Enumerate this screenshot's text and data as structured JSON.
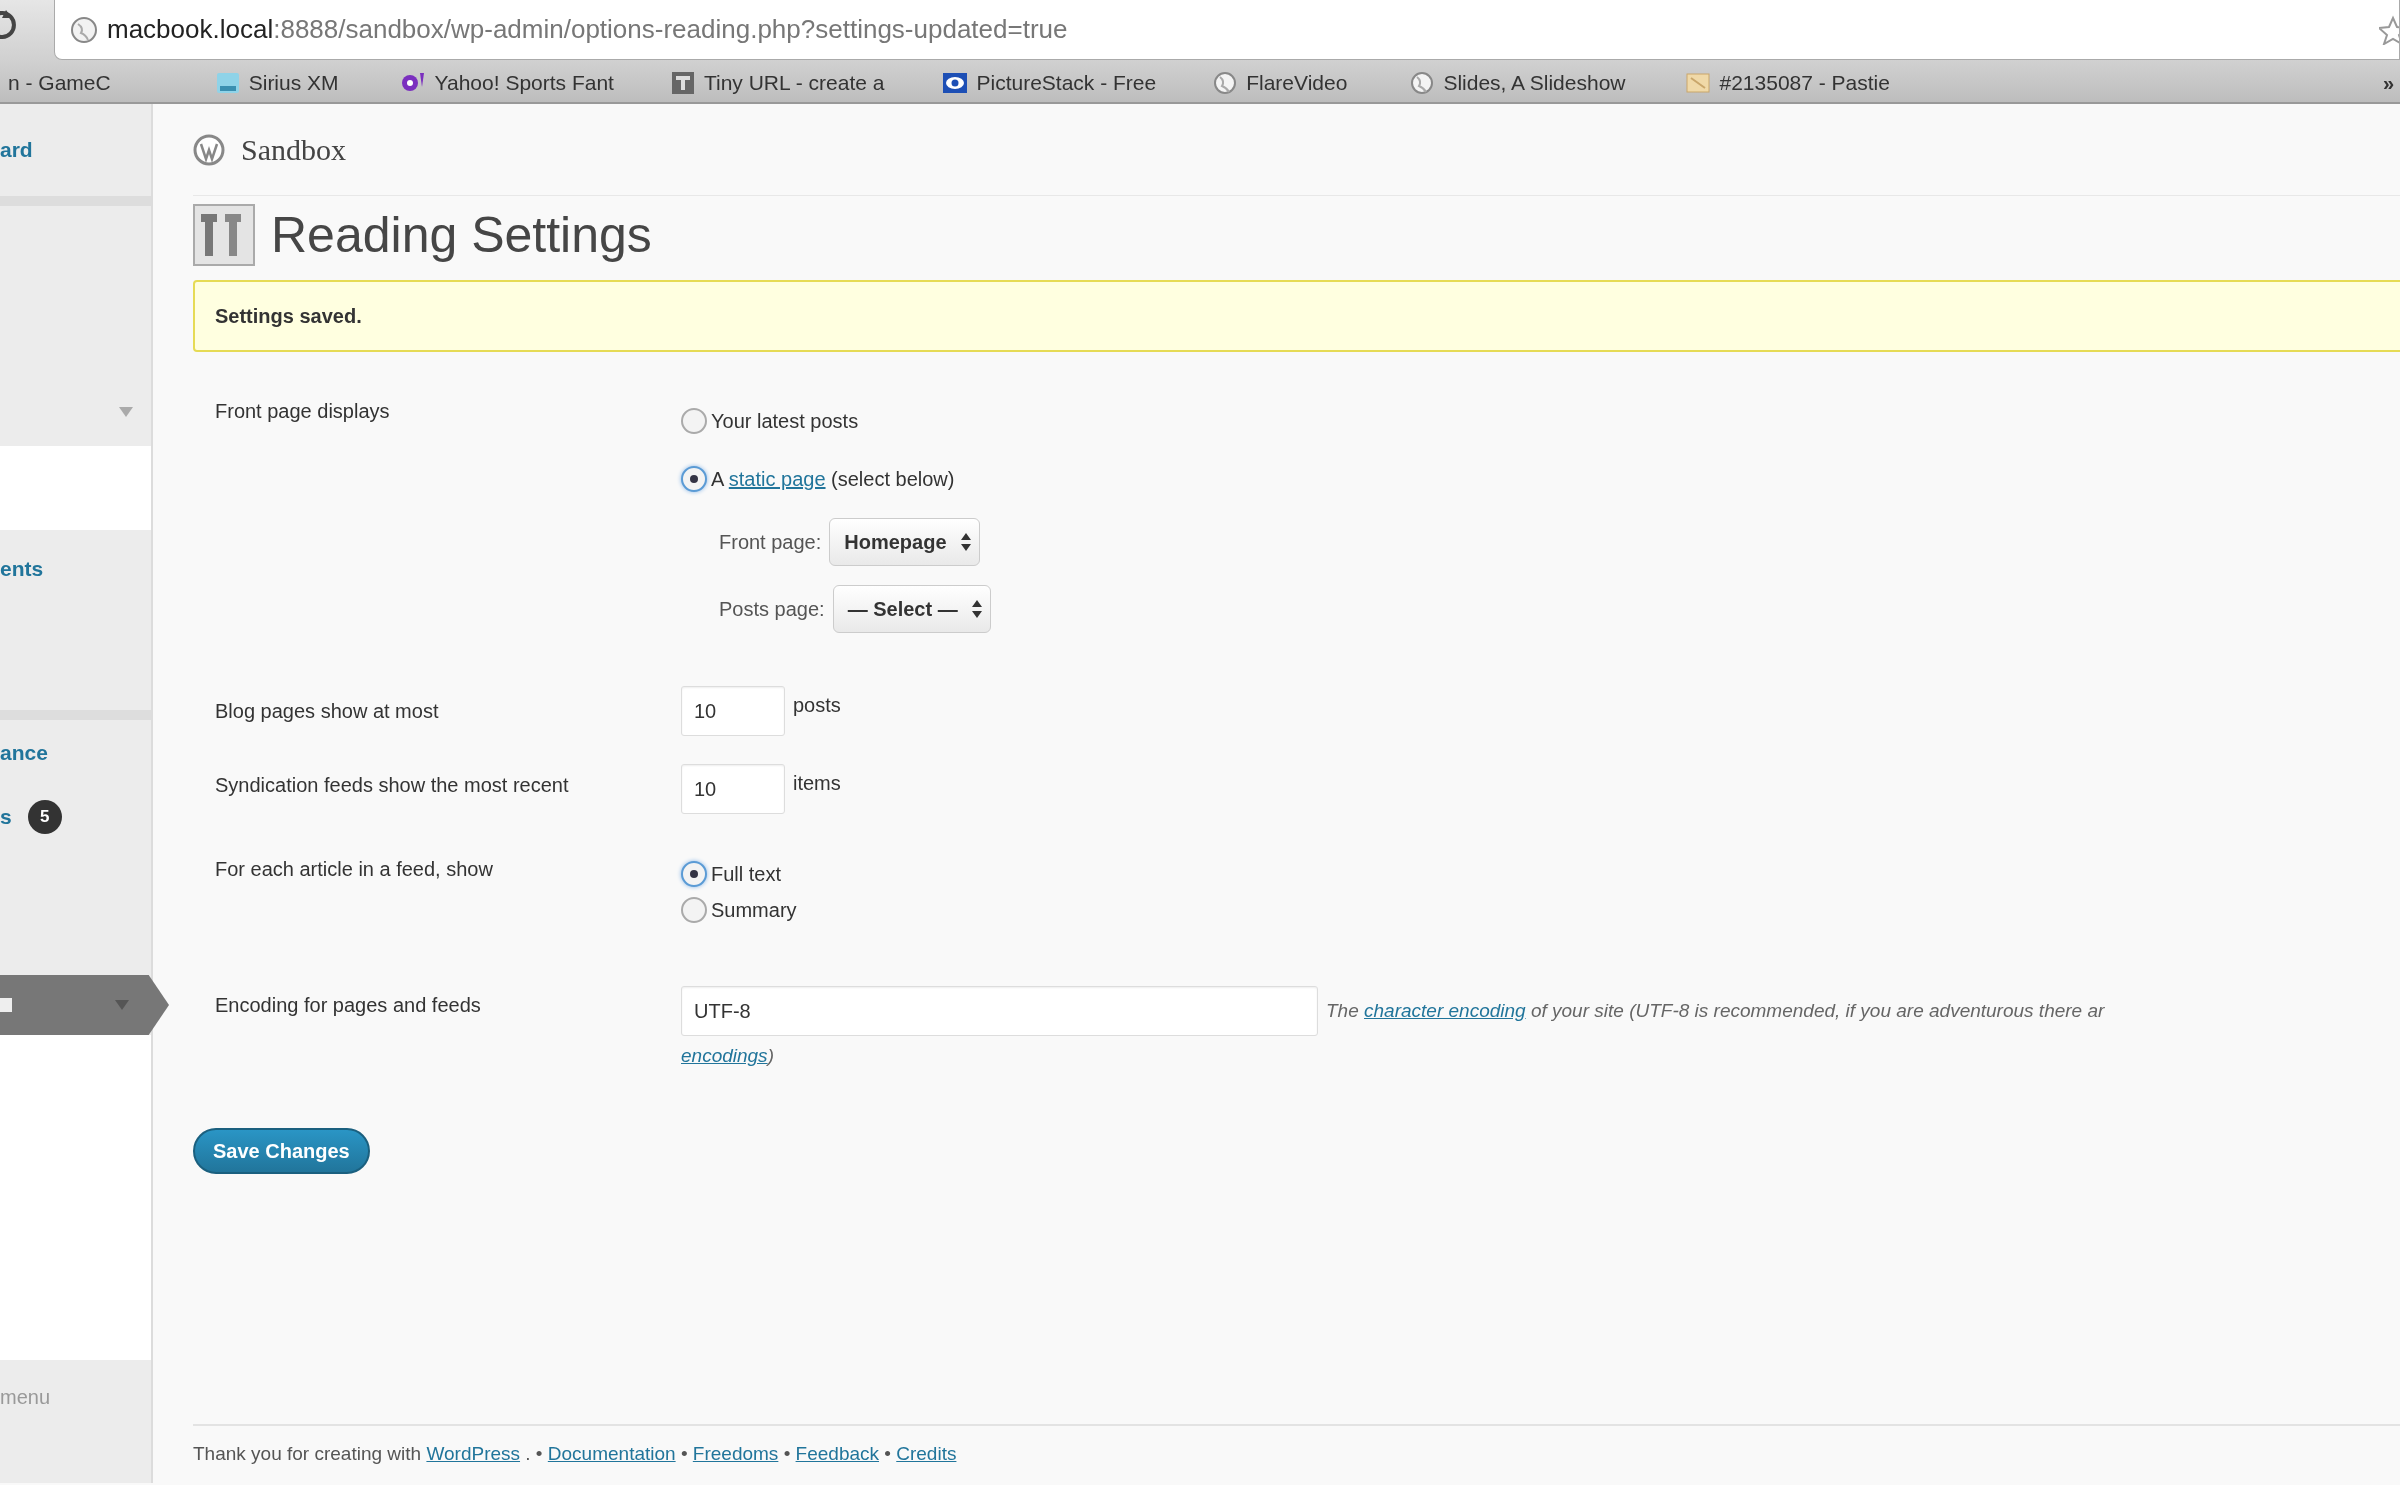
{
  "browser": {
    "url_host": "macbook.local",
    "url_rest": ":8888/sandbox/wp-admin/options-reading.php?settings-updated=true",
    "bookmarks": [
      {
        "label": "n - GameC"
      },
      {
        "label": "Sirius XM"
      },
      {
        "label": "Yahoo! Sports Fant"
      },
      {
        "label": "Tiny URL - create a"
      },
      {
        "label": "PictureStack - Free"
      },
      {
        "label": "FlareVideo"
      },
      {
        "label": "Slides, A Slideshow"
      },
      {
        "label": "#2135087 - Pastie"
      }
    ],
    "overflow": "»"
  },
  "sidebar": {
    "items": [
      {
        "label": "ard",
        "selected": false,
        "has_submenu": false
      },
      {
        "selected": false,
        "has_submenu": true
      },
      {
        "label": "ents",
        "selected": false,
        "has_submenu": false
      },
      {
        "label": "ance",
        "selected": false,
        "has_submenu": false
      },
      {
        "label": "s",
        "badge": "5",
        "selected": false,
        "has_submenu": false
      },
      {
        "selected": true,
        "has_submenu": true
      }
    ],
    "collapse": "menu"
  },
  "site_name": "Sandbox",
  "page_title": "Reading Settings",
  "notice": "Settings saved.",
  "form": {
    "front_page": {
      "label": "Front page displays",
      "options": [
        {
          "text": "Your latest posts",
          "selected": false
        },
        {
          "before": "A",
          "link": "static page",
          "after": "(select below)",
          "selected": true
        }
      ],
      "selects": [
        {
          "label": "Front page:",
          "value": "Homepage"
        },
        {
          "label": "Posts page:",
          "value": "— Select —"
        }
      ]
    },
    "blog_pages": {
      "label": "Blog pages show at most",
      "value": "10",
      "unit": "posts"
    },
    "syndication": {
      "label": "Syndication feeds show the most recent",
      "value": "10",
      "unit": "items"
    },
    "feed_article": {
      "label": "For each article in a feed, show",
      "options": [
        {
          "text": "Full text",
          "selected": true
        },
        {
          "text": "Summary",
          "selected": false
        }
      ]
    },
    "encoding": {
      "label": "Encoding for pages and feeds",
      "value": "UTF-8",
      "desc_before": "The",
      "desc_link": "character encoding",
      "desc_after": "of your site (UTF-8 is recommended, if you are adventurous there ar",
      "desc_link2": "encodings",
      "desc_end": ")"
    }
  },
  "save_button": "Save Changes",
  "footer": [
    {
      "kind": "text",
      "text": "Thank you for creating with"
    },
    {
      "kind": "link",
      "text": "WordPress"
    },
    {
      "kind": "text",
      "text": ". •"
    },
    {
      "kind": "link",
      "text": "Documentation"
    },
    {
      "kind": "text",
      "text": "•"
    },
    {
      "kind": "link",
      "text": "Freedoms"
    },
    {
      "kind": "text",
      "text": "•"
    },
    {
      "kind": "link",
      "text": "Feedback"
    },
    {
      "kind": "text",
      "text": "•"
    },
    {
      "kind": "link",
      "text": "Credits"
    }
  ]
}
